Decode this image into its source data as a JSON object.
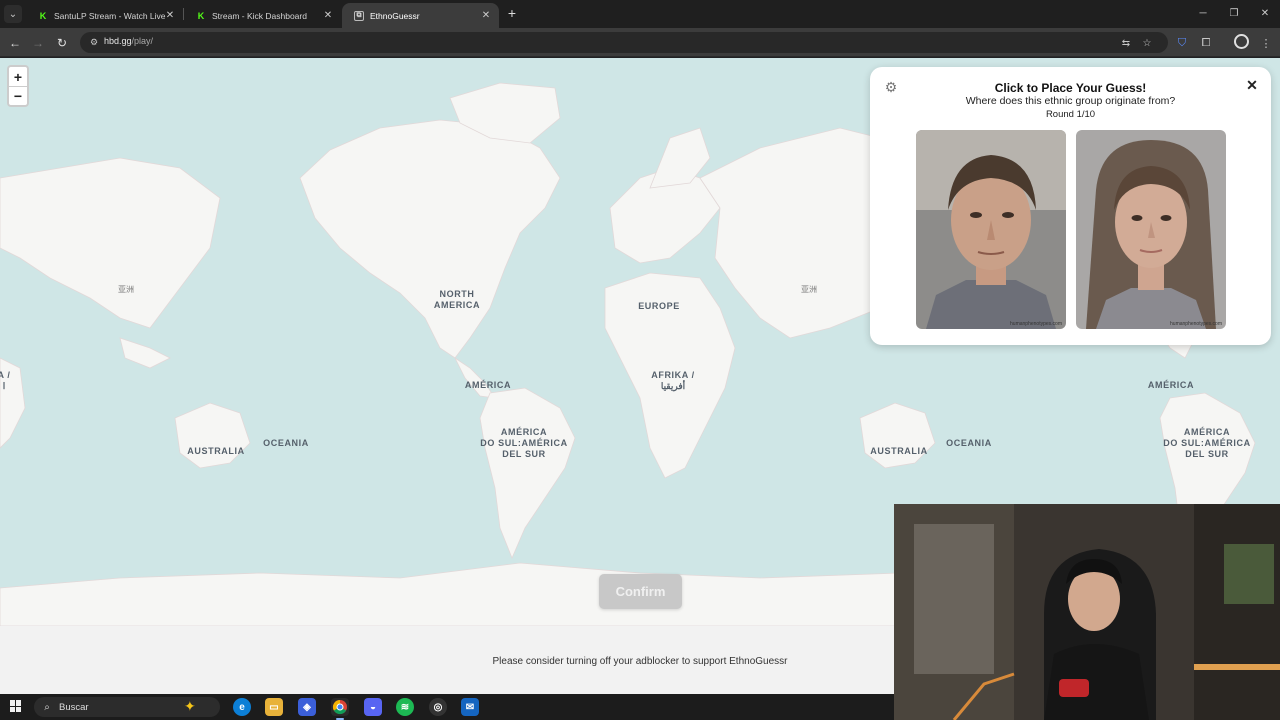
{
  "browser": {
    "tabs": [
      {
        "title": "SantuLP Stream - Watch Live on Kick",
        "favicon": "kick-icon"
      },
      {
        "title": "Stream - Kick Dashboard",
        "favicon": "kick-icon"
      },
      {
        "title": "EthnoGuessr",
        "favicon": "ethnoguessr-icon",
        "active": true
      }
    ],
    "url_host": "hbd.gg",
    "url_path": "/play/"
  },
  "map": {
    "labels": {
      "asia_left": "亚洲",
      "asia_right": "亚洲",
      "north_america_1": "NORTH",
      "north_america_2": "AMERICA",
      "europe": "EUROPE",
      "america_mid": "AMÉRICA",
      "america_right": "AMÉRICA",
      "afrika_1": "AFRIKA /",
      "afrika_2": "أفريقيا",
      "africa_edge_1": "A /",
      "africa_edge_2": "ا",
      "australia_left": "AUSTRALIA",
      "oceania_left": "OCEANIA",
      "australia_right": "AUSTRALIA",
      "oceania_right": "OCEANIA",
      "south_america_mid_1": "AMÉRICA",
      "south_america_mid_2": "DO SUL:AMÉRICA",
      "south_america_mid_3": "DEL SUR",
      "south_america_right_1": "AMÉRICA",
      "south_america_right_2": "DO SUL:AMÉRICA",
      "south_america_right_3": "DEL SUR"
    },
    "zoom_in": "+",
    "zoom_out": "−"
  },
  "panel": {
    "title": "Click to Place Your Guess!",
    "subtitle": "Where does this ethnic group originate from?",
    "round": "Round 1/10",
    "faces": [
      {
        "label": "male composite face",
        "credit": "humanphenotypes.com"
      },
      {
        "label": "female composite face",
        "credit": "humanphenotypes.com"
      }
    ]
  },
  "confirm_label": "Confirm",
  "footer_note": "Please consider turning off your adblocker to support EthnoGuessr",
  "taskbar": {
    "search_placeholder": "Buscar"
  }
}
